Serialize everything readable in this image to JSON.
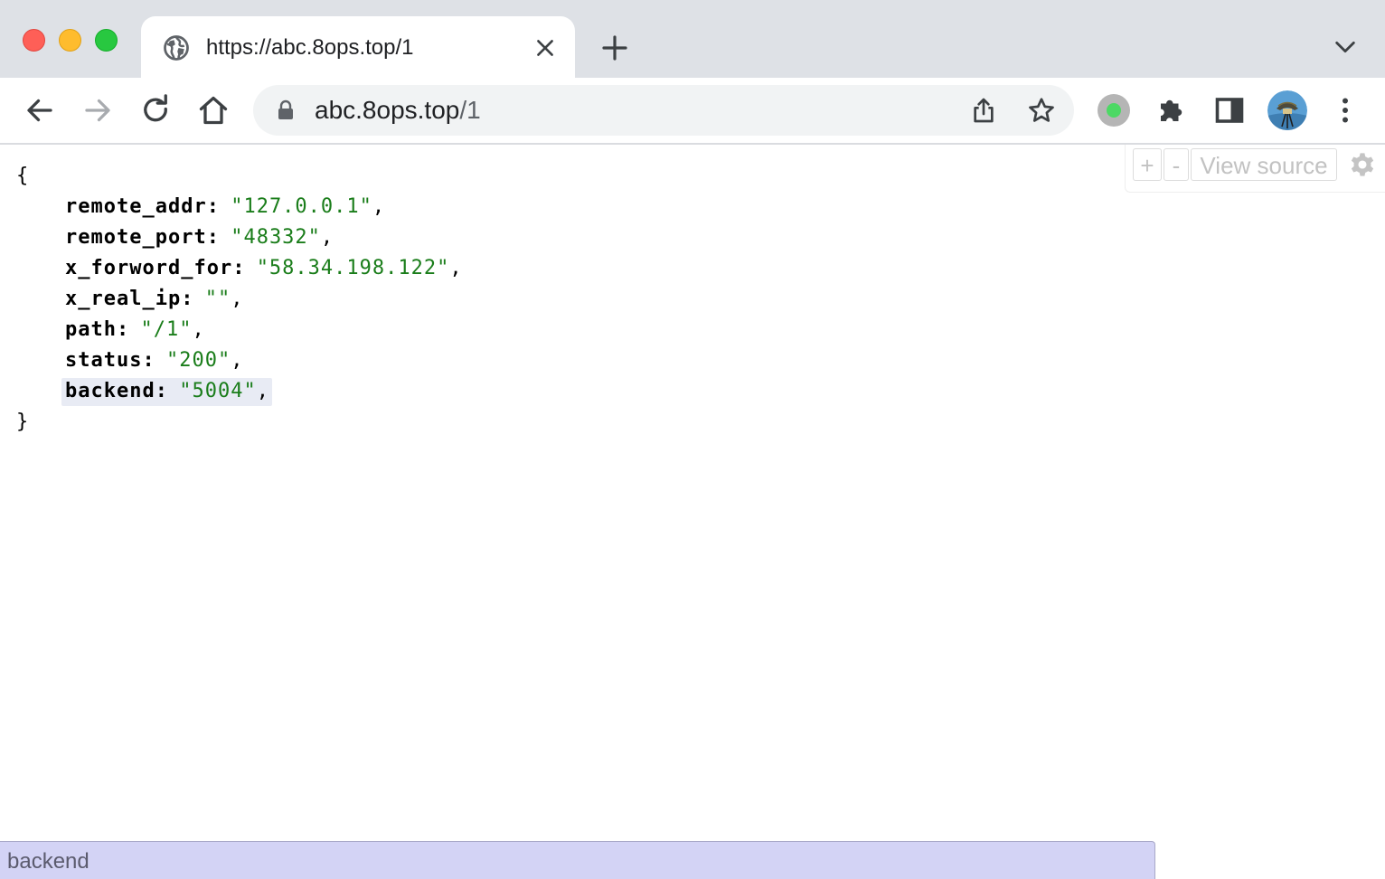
{
  "browser": {
    "tab": {
      "title": "https://abc.8ops.top/1",
      "favicon": "globe-icon"
    },
    "omnibox": {
      "host": "abc.8ops.top",
      "path": "/1"
    },
    "colors": {
      "tabstrip": "#dee1e6",
      "omnibox_bg": "#f1f3f4"
    }
  },
  "json_viewer": {
    "open_brace": "{",
    "close_brace": "}",
    "entries": [
      {
        "key": "remote_addr",
        "value": "\"127.0.0.1\""
      },
      {
        "key": "remote_port",
        "value": "\"48332\""
      },
      {
        "key": "x_forword_for",
        "value": "\"58.34.198.122\""
      },
      {
        "key": "x_real_ip",
        "value": "\"\""
      },
      {
        "key": "path",
        "value": "\"/1\""
      },
      {
        "key": "status",
        "value": "\"200\""
      },
      {
        "key": "backend",
        "value": "\"5004\""
      }
    ],
    "controls": {
      "expand_label": "+",
      "collapse_label": "-",
      "view_source_label": "View source"
    },
    "string_color": "#1a7d1a"
  },
  "status_bubble": {
    "text": "backend"
  }
}
